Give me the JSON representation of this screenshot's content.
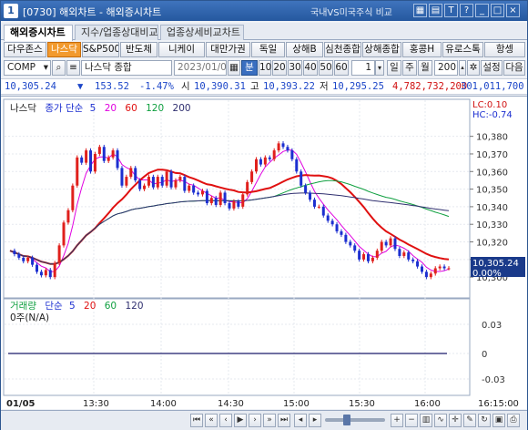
{
  "titlebar": {
    "code": "[0730]",
    "title": "해외차트 - 해외증시차트",
    "right_text": "국내VS미국주식 비교",
    "icon_label": "1"
  },
  "tabs": [
    "해외증시차트",
    "지수/업종상대비교",
    "업종상세비교차트"
  ],
  "markets": [
    "다우존스",
    "나스닥",
    "S&P500",
    "반도체",
    "니케이",
    "대만가권",
    "독일",
    "상해B",
    "심천종합",
    "상해종합",
    "홍콩H",
    "유로스톡",
    "항셍"
  ],
  "active_market": "나스닥",
  "controls": {
    "category": "COMP",
    "symbol_name": "나스닥 종합",
    "date": "2023/01/06",
    "unit_active": "분",
    "intervals": [
      "10",
      "20",
      "30",
      "40",
      "50",
      "60"
    ],
    "count": "1",
    "periods": [
      "일",
      "주",
      "월"
    ],
    "bars": "200",
    "settings": "설정",
    "next": "다음"
  },
  "quote": {
    "price": "10,305.24",
    "arrow": "▼",
    "change": "153.52",
    "change_pct": "-1.47%",
    "open_label": "시",
    "open": "10,390.31",
    "high_label": "고",
    "high": "10,393.22",
    "low_label": "저",
    "low": "10,295.25",
    "amount": "4,782,732,200",
    "volume": "301,011,700"
  },
  "price_pane": {
    "legend": {
      "name": "나스닥",
      "ma_title": "종가 단순",
      "periods": [
        "5",
        "20",
        "60",
        "120",
        "200"
      ]
    },
    "lc_label": "LC:0.10",
    "hc_label": "HC:-0.74",
    "current_price": "10,305.24",
    "current_pct": "0.00%",
    "y_ticks": [
      "10,380",
      "10,370",
      "10,360",
      "10,350",
      "10,340",
      "10,330",
      "10,320",
      "10,310",
      "10,300"
    ],
    "y_range": [
      10298,
      10385
    ]
  },
  "volume_pane": {
    "legend": {
      "name": "거래량",
      "ma_title": "단순",
      "periods": [
        "5",
        "20",
        "60",
        "120"
      ]
    },
    "status": "0주(N/A)",
    "y_ticks": [
      "0.03",
      "0",
      "-0.03"
    ]
  },
  "x_axis": {
    "date_label": "01/05",
    "ticks": [
      "13:30",
      "14:00",
      "14:30",
      "15:00",
      "15:30",
      "16:00"
    ],
    "end_time": "16:15:00"
  },
  "colors": {
    "up": "#e0201c",
    "down": "#1c2fd0",
    "ma5": "#e000e0",
    "ma20": "#e01010",
    "ma60": "#10a040",
    "ma120": "#303070",
    "price_tag": "#1a3a8a"
  }
}
